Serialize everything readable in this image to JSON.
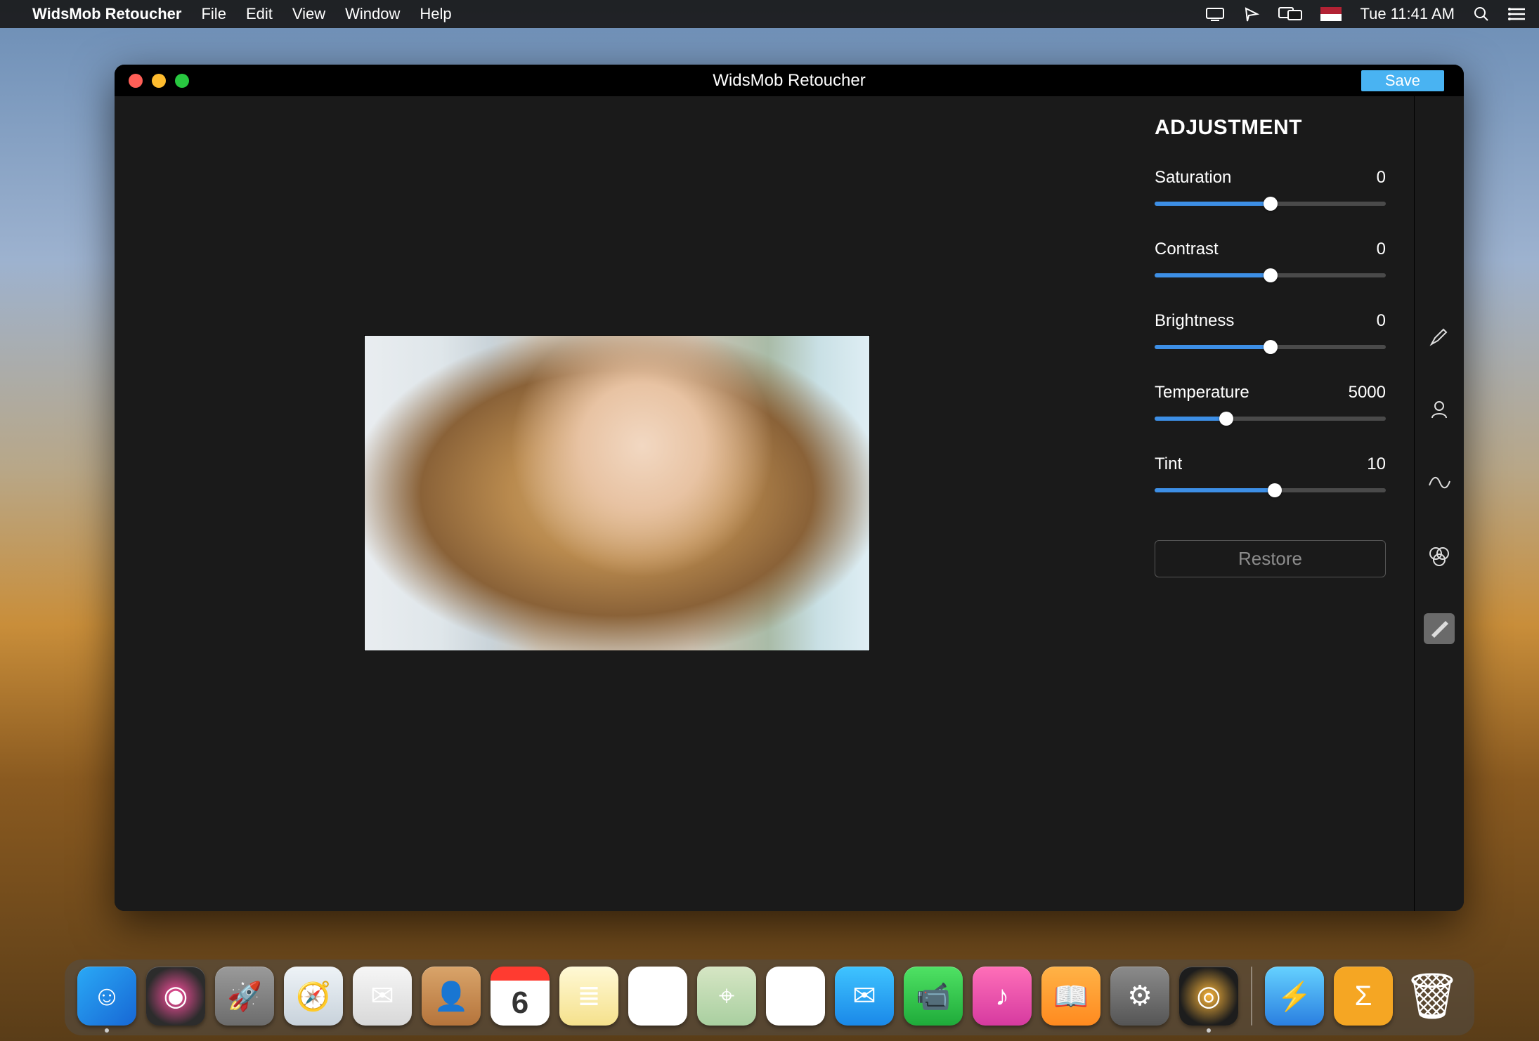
{
  "menubar": {
    "app_name": "WidsMob Retoucher",
    "items": [
      "File",
      "Edit",
      "View",
      "Window",
      "Help"
    ],
    "clock": "Tue 11:41 AM"
  },
  "window": {
    "title": "WidsMob Retoucher",
    "save_label": "Save"
  },
  "panel": {
    "title": "ADJUSTMENT",
    "restore_label": "Restore",
    "sliders": [
      {
        "label": "Saturation",
        "value": "0",
        "fill_pct": 50,
        "thumb_pct": 50
      },
      {
        "label": "Contrast",
        "value": "0",
        "fill_pct": 50,
        "thumb_pct": 50
      },
      {
        "label": "Brightness",
        "value": "0",
        "fill_pct": 50,
        "thumb_pct": 50
      },
      {
        "label": "Temperature",
        "value": "5000",
        "fill_pct": 31,
        "thumb_pct": 31
      },
      {
        "label": "Tint",
        "value": "10",
        "fill_pct": 52,
        "thumb_pct": 52
      }
    ]
  },
  "tools": [
    {
      "name": "brush-tool-icon",
      "active": false
    },
    {
      "name": "portrait-tool-icon",
      "active": false
    },
    {
      "name": "denoise-tool-icon",
      "active": false
    },
    {
      "name": "filmpack-tool-icon",
      "active": false
    },
    {
      "name": "adjust-tool-icon",
      "active": true
    }
  ],
  "dock": [
    {
      "name": "finder",
      "bg": "linear-gradient(135deg,#2aa9f6,#1767d4)",
      "glyph": "☺",
      "running": true
    },
    {
      "name": "siri",
      "bg": "radial-gradient(circle,#ff4fa0,#2c2c2c 70%)",
      "glyph": "◉"
    },
    {
      "name": "launchpad",
      "bg": "linear-gradient(#9a9a9a,#6c6c6c)",
      "glyph": "🚀"
    },
    {
      "name": "safari",
      "bg": "linear-gradient(#eef3f7,#c8d2db)",
      "glyph": "🧭"
    },
    {
      "name": "mail",
      "bg": "linear-gradient(#f6f6f6,#d8d8d8)",
      "glyph": "✉"
    },
    {
      "name": "contacts",
      "bg": "linear-gradient(#d9a46a,#b5743b)",
      "glyph": "👤"
    },
    {
      "name": "calendar",
      "bg": "#fff",
      "glyph": "6"
    },
    {
      "name": "notes",
      "bg": "linear-gradient(#fff9d6,#f5e18c)",
      "glyph": "≣"
    },
    {
      "name": "reminders",
      "bg": "#fff",
      "glyph": "☑"
    },
    {
      "name": "maps",
      "bg": "linear-gradient(#d6e6c4,#a9cfa0)",
      "glyph": "⌖"
    },
    {
      "name": "photos",
      "bg": "#fff",
      "glyph": "✿"
    },
    {
      "name": "messages",
      "bg": "linear-gradient(#3fc4ff,#1a88e8)",
      "glyph": "✉"
    },
    {
      "name": "facetime",
      "bg": "linear-gradient(#4fe264,#1fab3a)",
      "glyph": "📹"
    },
    {
      "name": "itunes",
      "bg": "linear-gradient(#ff6fb8,#d63aa0)",
      "glyph": "♪"
    },
    {
      "name": "ibooks",
      "bg": "linear-gradient(#ffb347,#ff8a1f)",
      "glyph": "📖"
    },
    {
      "name": "preferences",
      "bg": "linear-gradient(#8b8b8b,#555)",
      "glyph": "⚙"
    },
    {
      "name": "retoucher-app",
      "bg": "radial-gradient(circle,#f6b23a,#1d1d1d 70%)",
      "glyph": "◎",
      "running": true
    }
  ],
  "dock_right": [
    {
      "name": "app-extra-1",
      "bg": "linear-gradient(#65d1ff,#2a7fe0)",
      "glyph": "⚡"
    },
    {
      "name": "app-extra-2",
      "bg": "#f5a623",
      "glyph": "Σ"
    },
    {
      "name": "trash",
      "bg": "linear-gradient(#e8e8e8,#bdbdbd)",
      "glyph": "🗑"
    }
  ]
}
